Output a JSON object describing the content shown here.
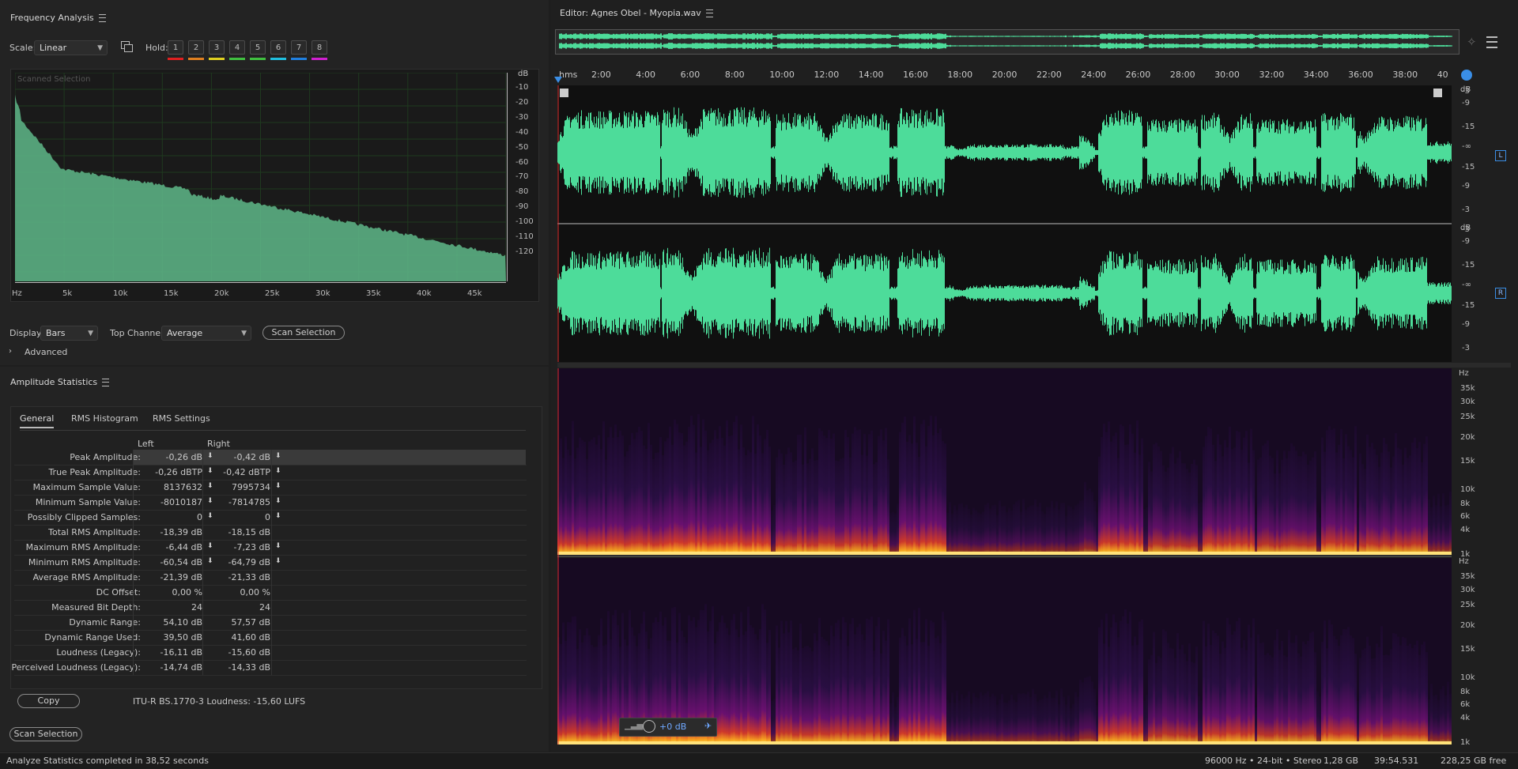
{
  "freq": {
    "title": "Frequency Analysis",
    "scale_label": "Scale:",
    "scale_value": "Linear",
    "hold_label": "Hold:",
    "holds": [
      "1",
      "2",
      "3",
      "4",
      "5",
      "6",
      "7",
      "8"
    ],
    "hold_colors": [
      "#e02020",
      "#e08020",
      "#e0d020",
      "#40c040",
      "#40c040",
      "#20c0e0",
      "#2080e0",
      "#d020d0"
    ],
    "graph_label": "Scanned Selection",
    "db_unit": "dB",
    "db_ticks": [
      "-10",
      "-20",
      "-30",
      "-40",
      "-50",
      "-60",
      "-70",
      "-80",
      "-90",
      "-100",
      "-110",
      "-120"
    ],
    "hz_ticks": [
      "Hz",
      "5k",
      "10k",
      "15k",
      "20k",
      "25k",
      "30k",
      "35k",
      "40k",
      "45k"
    ],
    "display_label": "Display:",
    "display_value": "Bars",
    "top_channel_label": "Top Channel:",
    "top_channel_value": "Average",
    "scan_button": "Scan Selection",
    "advanced_label": "Advanced",
    "fill_color": "#5fb88a"
  },
  "amp": {
    "title": "Amplitude Statistics",
    "tabs": [
      "General",
      "RMS Histogram",
      "RMS Settings"
    ],
    "col_left": "Left",
    "col_right": "Right",
    "rows": [
      {
        "label": "Peak Amplitude:",
        "left": "-0,26 dB",
        "right": "-0,42 dB"
      },
      {
        "label": "True Peak Amplitude:",
        "left": "-0,26 dBTP",
        "right": "-0,42 dBTP"
      },
      {
        "label": "Maximum Sample Value:",
        "left": "8137632",
        "right": "7995734"
      },
      {
        "label": "Minimum Sample Value:",
        "left": "-8010187",
        "right": "-7814785"
      },
      {
        "label": "Possibly Clipped Samples:",
        "left": "0",
        "right": "0"
      },
      {
        "label": "Total RMS Amplitude:",
        "left": "-18,39 dB",
        "right": "-18,15 dB"
      },
      {
        "label": "Maximum RMS Amplitude:",
        "left": "-6,44 dB",
        "right": "-7,23 dB"
      },
      {
        "label": "Minimum RMS Amplitude:",
        "left": "-60,54 dB",
        "right": "-64,79 dB"
      },
      {
        "label": "Average RMS Amplitude:",
        "left": "-21,39 dB",
        "right": "-21,33 dB"
      },
      {
        "label": "DC Offset:",
        "left": "0,00 %",
        "right": "0,00 %"
      },
      {
        "label": "Measured Bit Depth:",
        "left": "24",
        "right": "24"
      },
      {
        "label": "Dynamic Range:",
        "left": "54,10 dB",
        "right": "57,57 dB"
      },
      {
        "label": "Dynamic Range Used:",
        "left": "39,50 dB",
        "right": "41,60 dB"
      },
      {
        "label": "Loudness (Legacy):",
        "left": "-16,11 dB",
        "right": "-15,60 dB"
      },
      {
        "label": "Perceived Loudness (Legacy):",
        "left": "-14,74 dB",
        "right": "-14,33 dB"
      }
    ],
    "copy_button": "Copy",
    "loudness_text": "ITU-R BS.1770-3 Loudness: -15,60 LUFS",
    "scan_button": "Scan Selection"
  },
  "editor": {
    "title": "Editor: Agnes Obel - Myopia.wav",
    "ruler_unit": "hms",
    "ruler_ticks": [
      "2:00",
      "4:00",
      "6:00",
      "8:00",
      "10:00",
      "12:00",
      "14:00",
      "16:00",
      "18:00",
      "20:00",
      "22:00",
      "24:00",
      "26:00",
      "28:00",
      "30:00",
      "32:00",
      "34:00",
      "36:00",
      "38:00",
      "40"
    ],
    "db_unit": "dB",
    "db_scale": [
      "-3",
      "-9",
      "-15",
      "-∞",
      "-15",
      "-9",
      "-3"
    ],
    "channel_left": "L",
    "channel_right": "R",
    "hz_unit": "Hz",
    "hz_scale": [
      "35k",
      "30k",
      "25k",
      "20k",
      "15k",
      "10k",
      "8k",
      "6k",
      "4k",
      "1k"
    ],
    "gain": "+0 dB",
    "wave_color": "#4ddc9a"
  },
  "status": {
    "message": "Analyze Statistics completed in 38,52 seconds",
    "format": "96000 Hz • 24-bit • Stereo",
    "size": "1,28 GB",
    "duration": "39:54.531",
    "free": "228,25 GB free"
  }
}
